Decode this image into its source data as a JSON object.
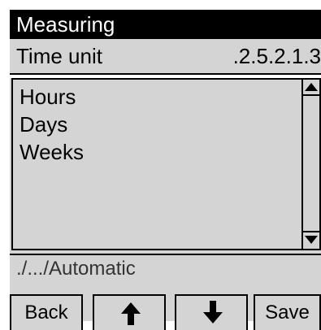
{
  "title": "Measuring",
  "path": {
    "label": "Time unit",
    "code": ".2.5.2.1.3"
  },
  "list": {
    "items": [
      "Hours",
      "Days",
      "Weeks"
    ]
  },
  "status": "./.../Automatic",
  "softkeys": {
    "back": "Back",
    "up_icon": "arrow-up-icon",
    "down_icon": "arrow-down-icon",
    "save": "Save"
  }
}
